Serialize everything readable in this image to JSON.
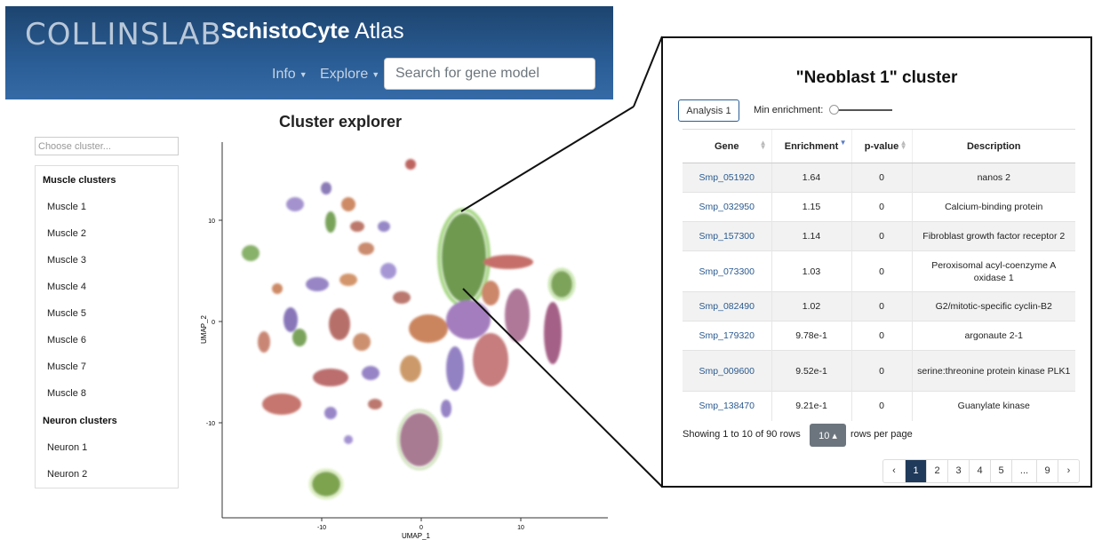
{
  "header": {
    "logo": "COLLINSLAB",
    "title_bold": "SchistoCyte",
    "title_rest": " Atlas",
    "nav": [
      "Info",
      "Explore"
    ],
    "search_placeholder": "Search for gene model"
  },
  "explorer": {
    "title": "Cluster explorer",
    "choose_placeholder": "Choose cluster...",
    "groups": [
      {
        "label": "Muscle clusters",
        "items": [
          "Muscle 1",
          "Muscle 2",
          "Muscle 3",
          "Muscle 4",
          "Muscle 5",
          "Muscle 6",
          "Muscle 7",
          "Muscle 8"
        ]
      },
      {
        "label": "Neuron clusters",
        "items": [
          "Neuron 1",
          "Neuron 2"
        ]
      }
    ]
  },
  "plot": {
    "xlabel": "UMAP_1",
    "ylabel": "UMAP_2",
    "xticks": [
      "-10",
      "0",
      "10"
    ],
    "yticks": [
      "10",
      "0",
      "-10"
    ]
  },
  "panel": {
    "title": "\"Neoblast 1\" cluster",
    "analysis_button": "Analysis 1",
    "min_enrichment_label": "Min enrichment:",
    "columns": [
      "Gene",
      "Enrichment",
      "p-value",
      "Description"
    ],
    "rows": [
      {
        "gene": "Smp_051920",
        "enrichment": "1.64",
        "pvalue": "0",
        "description": "nanos 2"
      },
      {
        "gene": "Smp_032950",
        "enrichment": "1.15",
        "pvalue": "0",
        "description": "Calcium-binding protein"
      },
      {
        "gene": "Smp_157300",
        "enrichment": "1.14",
        "pvalue": "0",
        "description": "Fibroblast growth factor receptor 2"
      },
      {
        "gene": "Smp_073300",
        "enrichment": "1.03",
        "pvalue": "0",
        "description": "Peroxisomal acyl-coenzyme A oxidase 1"
      },
      {
        "gene": "Smp_082490",
        "enrichment": "1.02",
        "pvalue": "0",
        "description": "G2/mitotic-specific cyclin-B2"
      },
      {
        "gene": "Smp_179320",
        "enrichment": "9.78e-1",
        "pvalue": "0",
        "description": "argonaute 2-1"
      },
      {
        "gene": "Smp_009600",
        "enrichment": "9.52e-1",
        "pvalue": "0",
        "description": "serine:threonine protein kinase PLK1"
      },
      {
        "gene": "Smp_138470",
        "enrichment": "9.21e-1",
        "pvalue": "0",
        "description": "Guanylate kinase"
      }
    ],
    "showing": "Showing 1 to 10 of 90 rows",
    "rows_per_page_value": "10",
    "rows_per_page_label": "rows per page",
    "pages": [
      "‹",
      "1",
      "2",
      "3",
      "4",
      "5",
      "...",
      "9",
      "›"
    ],
    "active_page": "1"
  },
  "colors": {
    "header_dark": "#1d446f",
    "neoblast_green": "#6aa84f",
    "active_page": "#1f3a5a"
  }
}
